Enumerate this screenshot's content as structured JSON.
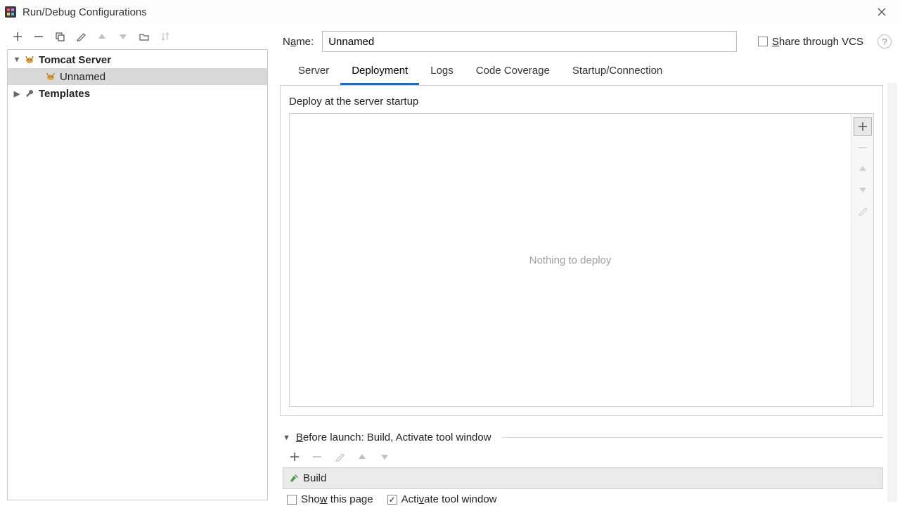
{
  "window": {
    "title": "Run/Debug Configurations"
  },
  "form": {
    "name_label_pre": "N",
    "name_label_ul": "a",
    "name_label_post": "me:",
    "name_value": "Unnamed",
    "share_pre": "",
    "share_ul": "S",
    "share_post": "hare through VCS",
    "share_checked": false
  },
  "tree": {
    "items": [
      {
        "label": "Tomcat Server",
        "bold": true,
        "expanded": true,
        "icon": "tomcat"
      },
      {
        "label": "Unnamed",
        "indent": 1,
        "selected": true,
        "icon": "tomcat"
      },
      {
        "label": "Templates",
        "bold": true,
        "expanded": false,
        "icon": "wrench"
      }
    ]
  },
  "tabs": [
    {
      "label": "Server",
      "active": false
    },
    {
      "label": "Deployment",
      "active": true
    },
    {
      "label": "Logs",
      "active": false
    },
    {
      "label": "Code Coverage",
      "active": false
    },
    {
      "label": "Startup/Connection",
      "active": false
    }
  ],
  "deployment": {
    "section_label": "Deploy at the server startup",
    "empty_text": "Nothing to deploy"
  },
  "before_launch": {
    "label_ul": "B",
    "label_post": "efore launch: Build, Activate tool window",
    "items": [
      {
        "label": "Build"
      }
    ],
    "show_this_page": {
      "ul": "w",
      "pre": "Sho",
      "post": " this page",
      "checked": false
    },
    "activate": {
      "ul": "v",
      "pre": "Acti",
      "post": "ate tool window",
      "checked": true
    }
  }
}
